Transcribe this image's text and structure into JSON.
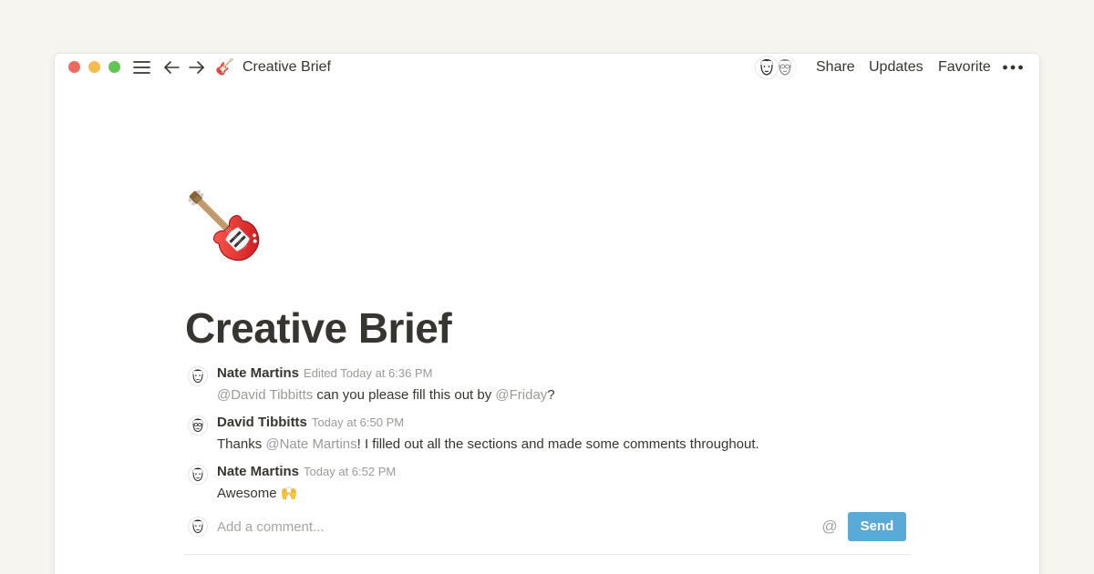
{
  "titlebar": {
    "breadcrumb_title": "Creative Brief",
    "page_emoji": "🎸",
    "actions": {
      "share": "Share",
      "updates": "Updates",
      "favorite": "Favorite"
    }
  },
  "page": {
    "emoji": "guitar-icon",
    "title": "Creative Brief"
  },
  "comments": [
    {
      "author": "Nate Martins",
      "time": "Edited Today at 6:36 PM",
      "body": [
        {
          "text": "@David Tibbitts",
          "mention": true
        },
        {
          "text": " can you please fill this out by ",
          "mention": false
        },
        {
          "text": "@Friday",
          "mention": true
        },
        {
          "text": "?",
          "mention": false
        }
      ]
    },
    {
      "author": "David Tibbitts",
      "time": "Today at 6:50 PM",
      "body": [
        {
          "text": "Thanks ",
          "mention": false
        },
        {
          "text": "@Nate Martins",
          "mention": true
        },
        {
          "text": "! I filled out all the sections and made some comments throughout.",
          "mention": false
        }
      ]
    },
    {
      "author": "Nate Martins",
      "time": "Today at 6:52 PM",
      "body": [
        {
          "text": "Awesome 🙌",
          "mention": false
        }
      ]
    }
  ],
  "composer": {
    "placeholder": "Add a comment...",
    "at_symbol": "@",
    "send_label": "Send"
  },
  "colors": {
    "background": "#f7f5f0",
    "text": "#37352f",
    "muted": "#9b9a97",
    "send_button": "#5aaad8",
    "traffic_close": "#ee6a5f",
    "traffic_min": "#f5bd4f",
    "traffic_max": "#61c454"
  }
}
